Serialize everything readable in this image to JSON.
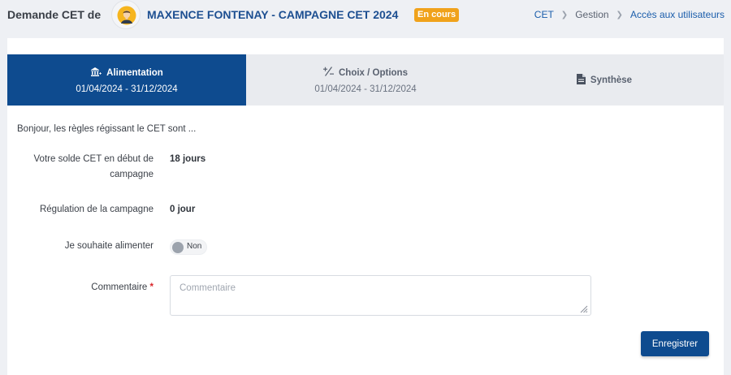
{
  "header": {
    "prefix": "Demande CET de",
    "title": "MAXENCE FONTENAY - CAMPAGNE CET 2024",
    "status_badge": "En cours",
    "avatar_icon": "user-avatar-icon"
  },
  "breadcrumb": {
    "items": [
      "CET",
      "Gestion",
      "Accès aux utilisateurs"
    ]
  },
  "tabs": [
    {
      "label": "Alimentation",
      "dates": "01/04/2024 - 31/12/2024",
      "icon": "bank-plus-icon",
      "active": true
    },
    {
      "label": "Choix / Options",
      "dates": "01/04/2024 - 31/12/2024",
      "icon": "plus-minus-icon",
      "active": false
    },
    {
      "label": "Synthèse",
      "dates": "",
      "icon": "document-icon",
      "active": false
    }
  ],
  "form": {
    "intro": "Bonjour, les règles régissant le CET sont ...",
    "solde_label_line1": "Votre solde CET en début de",
    "solde_label_line2": "campagne",
    "solde_value": "18 jours",
    "regulation_label": "Régulation de la campagne",
    "regulation_value": "0 jour",
    "alimenter_label": "Je souhaite alimenter",
    "alimenter_toggle_text": "Non",
    "alimenter_on": false,
    "commentaire_label": "Commentaire",
    "commentaire_required": "*",
    "commentaire_placeholder": "Commentaire",
    "commentaire_value": ""
  },
  "actions": {
    "save_label": "Enregistrer"
  },
  "colors": {
    "primary": "#0e4b8f",
    "link": "#1a5dab",
    "badge": "#f0a21b",
    "required": "#d9262b"
  }
}
